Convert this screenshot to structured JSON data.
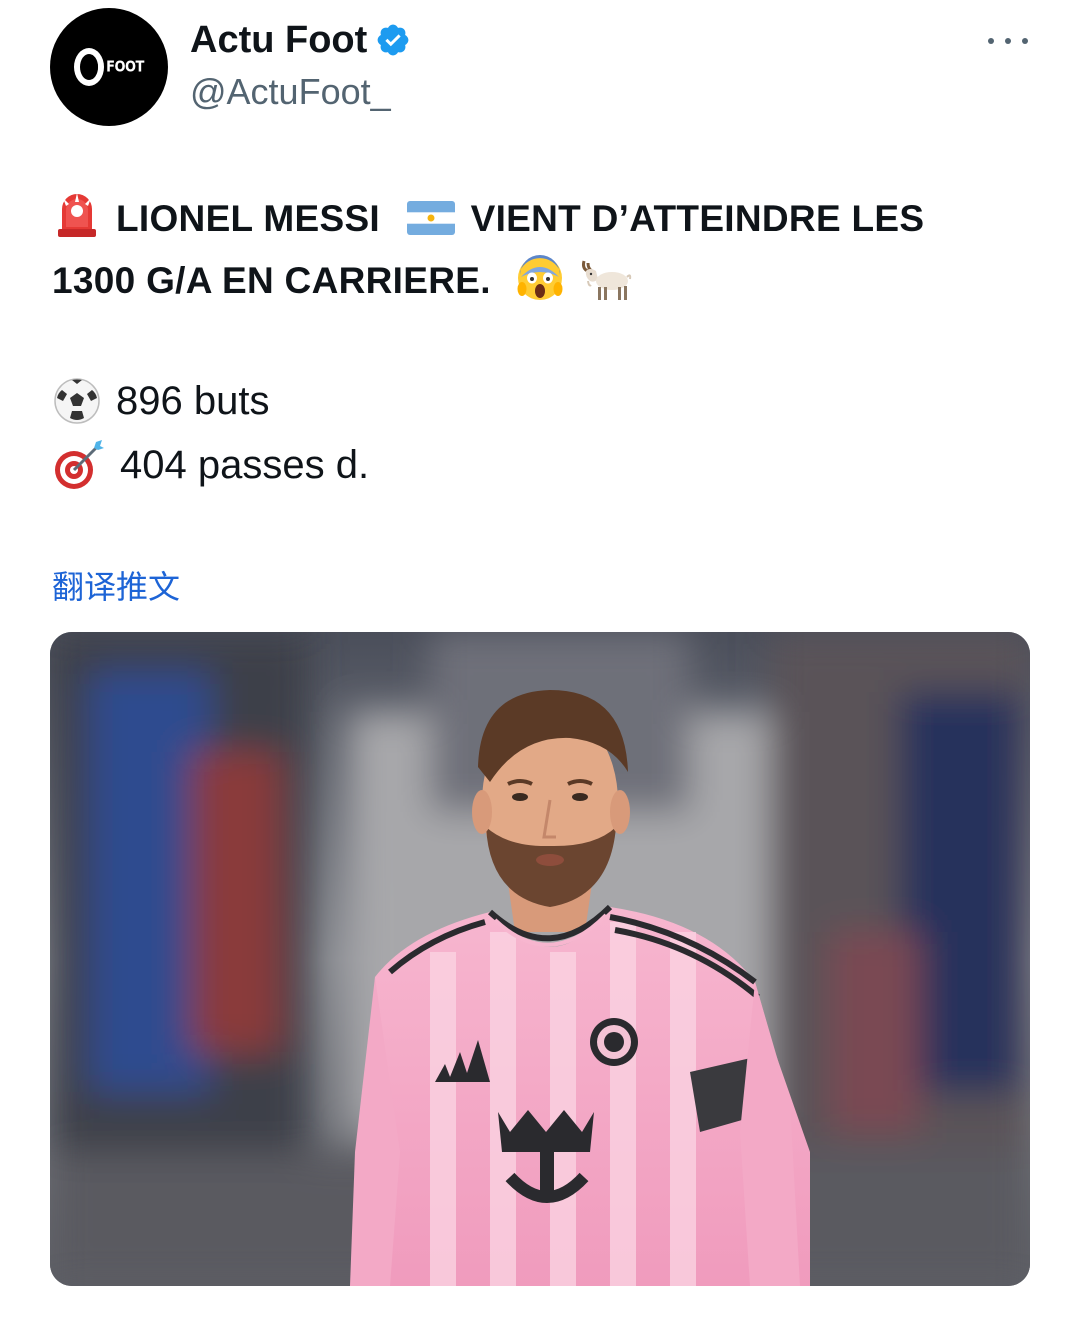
{
  "header": {
    "display_name": "Actu Foot",
    "handle": "@ActuFoot_",
    "avatar_text": "FOOT"
  },
  "tweet": {
    "line1": "LIONEL MESSI",
    "line1b": "VIENT D’ATTEINDRE LES",
    "line2": "1300 G/A EN CARRIERE.",
    "goals": "896 buts",
    "assists": "404 passes d.",
    "translate_label": "翻译推文"
  },
  "icons": {
    "siren": "rotating-light-icon",
    "flag": "argentina-flag-icon",
    "scream": "face-screaming-icon",
    "goat": "goat-icon",
    "ball": "soccer-ball-icon",
    "target": "direct-hit-icon",
    "verified": "verified-badge-icon",
    "more": "more-icon"
  },
  "colors": {
    "text": "#0f1419",
    "secondary": "#536471",
    "link": "#1d64d6",
    "verified": "#1d9bf0"
  }
}
